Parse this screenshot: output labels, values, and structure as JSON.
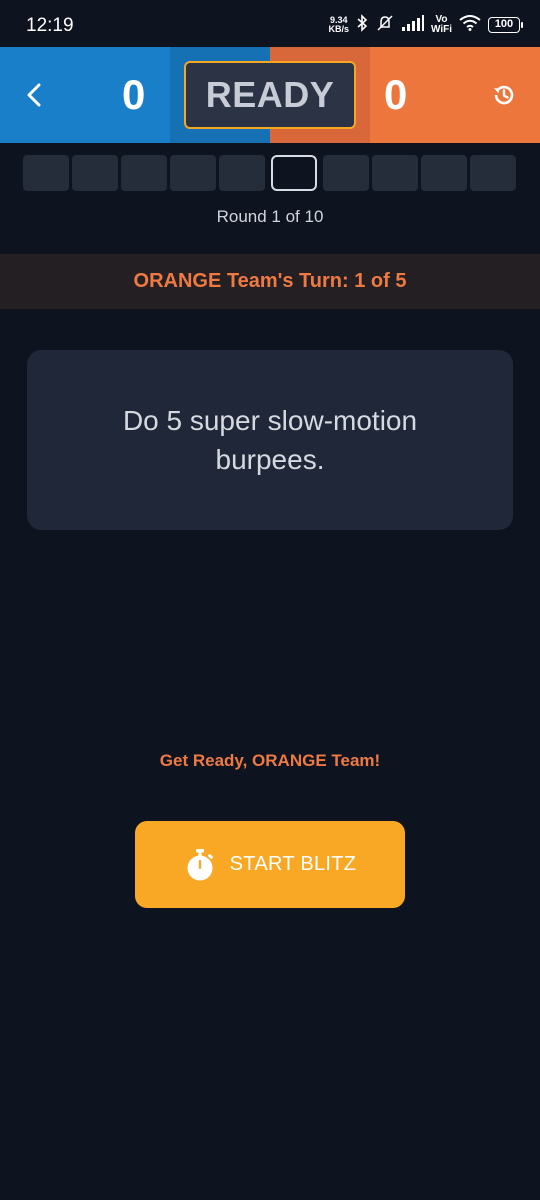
{
  "status_bar": {
    "time": "12:19",
    "speed_value": "9.34",
    "speed_unit": "KB/s",
    "network_label_top": "Vo",
    "network_label_bottom": "WiFi",
    "battery": "100"
  },
  "header": {
    "blue_score": "0",
    "orange_score": "0",
    "status": "READY",
    "colors": {
      "blue": "#1a7fc9",
      "orange": "#ec763c",
      "status_border": "#f5a623"
    },
    "icons": {
      "back": "chevron-left-icon",
      "history": "history-icon"
    }
  },
  "rounds": {
    "total_segments": 10,
    "current_index": 5,
    "label": "Round 1 of 10"
  },
  "turn": {
    "label": "ORANGE Team's Turn: 1 of 5"
  },
  "challenge": {
    "text": "Do 5 super slow-motion burpees."
  },
  "prompt": {
    "get_ready": "Get Ready, ORANGE Team!"
  },
  "start_button": {
    "label": "START BLITZ",
    "icon": "stopwatch-icon",
    "color": "#f9a825"
  }
}
